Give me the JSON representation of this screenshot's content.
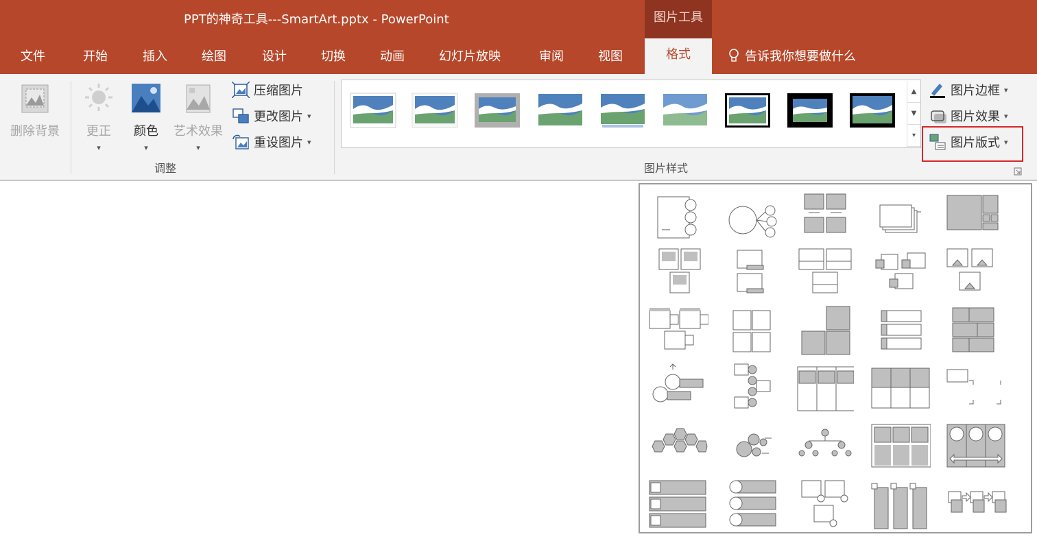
{
  "window": {
    "title": "PPT的神奇工具---SmartArt.pptx  -  PowerPoint",
    "context_header": "图片工具"
  },
  "tabs": [
    "文件",
    "开始",
    "插入",
    "绘图",
    "设计",
    "切换",
    "动画",
    "幻灯片放映",
    "审阅",
    "视图",
    "格式"
  ],
  "active_tab": "格式",
  "tell_me": "告诉我你想要做什么",
  "ribbon": {
    "adjust": {
      "remove_bg": "删除背景",
      "corrections": "更正",
      "color": "颜色",
      "artistic": "艺术效果",
      "compress": "压缩图片",
      "change": "更改图片",
      "reset": "重设图片",
      "group_label": "调整"
    },
    "styles": {
      "group_label": "图片样式",
      "border": "图片边框",
      "effects": "图片效果",
      "layout": "图片版式"
    }
  },
  "icons": [
    "remove-background-icon",
    "sun-icon",
    "color-icon",
    "artistic-effects-icon",
    "compress-icon",
    "change-picture-icon",
    "reset-picture-icon",
    "pen-icon",
    "effects-icon",
    "layout-icon",
    "dialog-launcher-icon"
  ],
  "colors": {
    "brand": "#b7472a",
    "context": "#8e3420",
    "highlight": "#d9262a"
  }
}
